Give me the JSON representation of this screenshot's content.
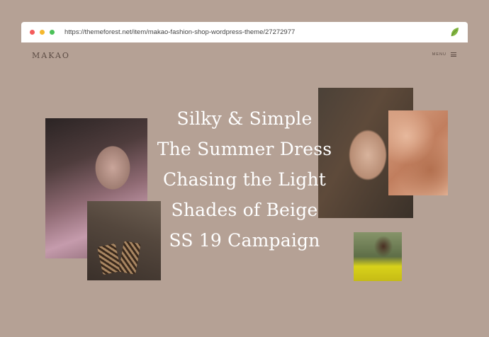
{
  "browser": {
    "url": "https://themeforest.net/item/makao-fashion-shop-wordpress-theme/27272977",
    "extension_icon": "envato-leaf-icon"
  },
  "site": {
    "logo": "MAKAO",
    "menu_label": "MENU",
    "menu_icon": "hamburger-icon",
    "titles": [
      "Silky & Simple",
      "The Summer Dress",
      "Chasing the Light",
      "Shades of Beige",
      "SS 19 Campaign"
    ]
  },
  "colors": {
    "background": "#b5a195",
    "text_dark": "#5c4c44",
    "title_text": "#ffffff"
  }
}
